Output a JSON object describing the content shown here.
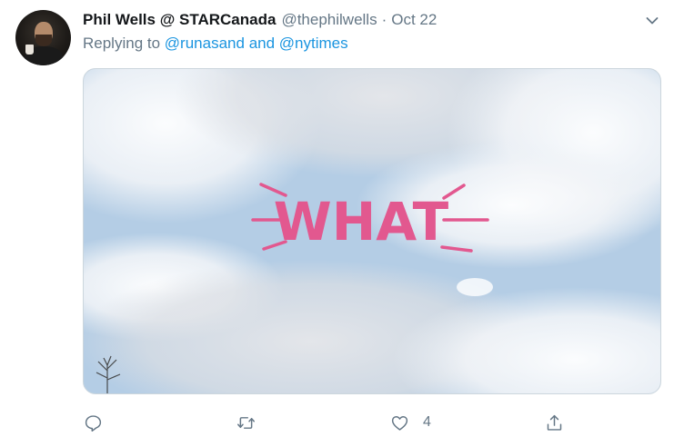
{
  "tweet": {
    "author_name": "Phil Wells @ STARCanada",
    "author_handle": "@thephilwells",
    "separator": "·",
    "date": "Oct 22",
    "replying_prefix": "Replying to",
    "replying_user_1": "@runasand",
    "replying_and": "and",
    "replying_user_2": "@nytimes",
    "media_text": "WHAT",
    "like_count": "4"
  },
  "icons": {
    "reply": "reply-icon",
    "retweet": "retweet-icon",
    "like": "heart-icon",
    "share": "share-icon",
    "more": "chevron-down-icon"
  },
  "colors": {
    "link": "#1b95e0",
    "muted": "#657786",
    "media_text": "#e2588f"
  }
}
